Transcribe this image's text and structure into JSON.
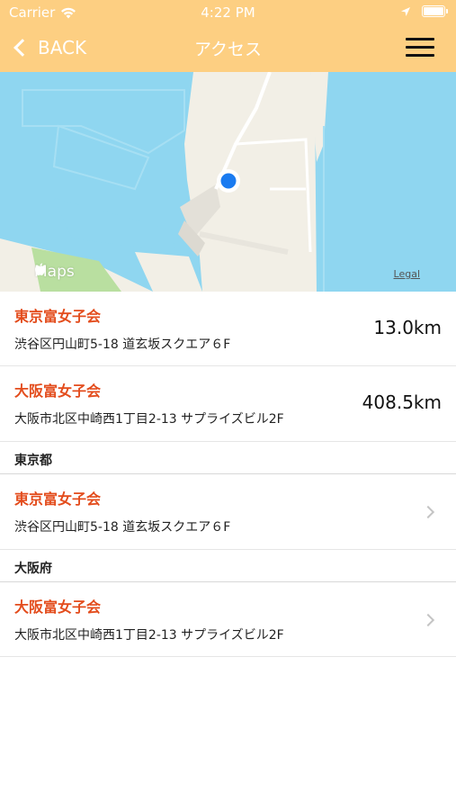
{
  "status_bar": {
    "carrier": "Carrier",
    "time": "4:22 PM",
    "icons": [
      "wifi-icon",
      "location-arrow-icon",
      "battery-icon"
    ]
  },
  "nav": {
    "back_label": "BACK",
    "title": "アクセス",
    "menu_icon": "hamburger-menu-icon"
  },
  "colors": {
    "header_bg": "#fdcf82",
    "accent": "#e34c1c",
    "map_water": "#8fd6f0",
    "map_land": "#f2efe6",
    "user_location": "#1a7bf0"
  },
  "map": {
    "logo_text": "Maps",
    "legal_text": "Legal"
  },
  "nearby": [
    {
      "name": "東京富女子会",
      "address": "渋谷区円山町5-18 道玄坂スクエア６F",
      "distance": "13.0km"
    },
    {
      "name": "大阪富女子会",
      "address": "大阪市北区中崎西1丁目2-13 サプライズビル2F",
      "distance": "408.5km"
    }
  ],
  "sections": [
    {
      "title": "東京都",
      "items": [
        {
          "name": "東京富女子会",
          "address": "渋谷区円山町5-18 道玄坂スクエア６F"
        }
      ]
    },
    {
      "title": "大阪府",
      "items": [
        {
          "name": "大阪富女子会",
          "address": "大阪市北区中崎西1丁目2-13 サプライズビル2F"
        }
      ]
    }
  ]
}
